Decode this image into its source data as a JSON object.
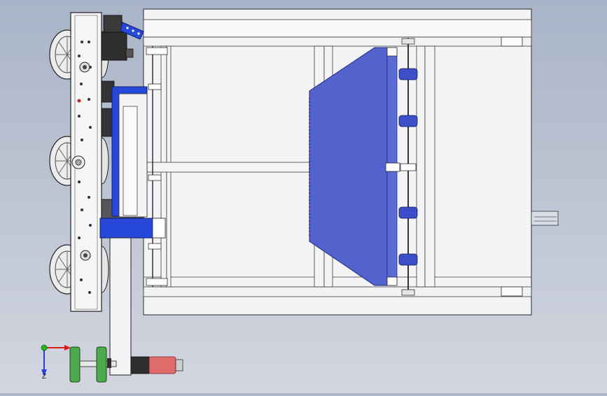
{
  "view": {
    "type": "cad-top-view",
    "background_top": "#a9b4c8",
    "background_bottom": "#d3d6df"
  },
  "triad": {
    "x_label": "",
    "y_label": "",
    "z_label": "Z",
    "colors": {
      "x": "#d91b1b",
      "y": "#1fb81f",
      "z": "#2a3fd1"
    }
  },
  "colors": {
    "frame": "#f4f4f6",
    "outline": "#2a2a2a",
    "blue_plate": "#5263cd",
    "blue_part": "#2748d8",
    "wheel_green": "#4ea84e",
    "motor_red": "#e06b6b",
    "dark_part": "#2e2e2e"
  }
}
